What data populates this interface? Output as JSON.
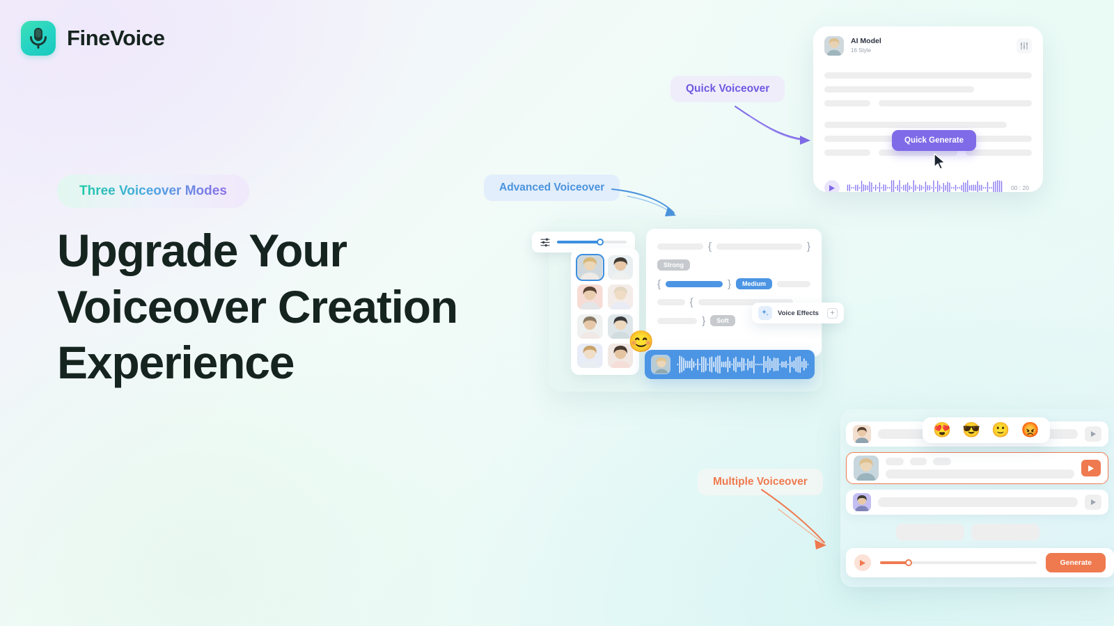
{
  "brand": {
    "name": "FineVoice",
    "logo_icon": "microphone-icon",
    "logo_color": "#2ed3b7"
  },
  "hero": {
    "badge": "Three Voiceover Modes",
    "headline": "Upgrade Your Voiceover Creation Experience",
    "headline_color": "#16241f"
  },
  "callouts": {
    "quick": {
      "label": "Quick Voiceover",
      "color": "#6f5ae0",
      "bg": "#f0edfb"
    },
    "advanced": {
      "label": "Advanced Voiceover",
      "color": "#4a93dd",
      "bg": "#e2eefb"
    },
    "multiple": {
      "label": "Multiple Voiceover",
      "color": "#ef7a50",
      "bg": "#f1f7f4"
    }
  },
  "quick_card": {
    "model_name": "AI Model",
    "model_style": "16 Style",
    "eq_icon": "equalizer-icon",
    "generate_label": "Quick Generate",
    "generate_color": "#7f6ae8",
    "cursor_icon": "mouse-cursor-icon",
    "play_icon": "play-icon",
    "duration": "00 : 20",
    "waveform_color": "#8b7cf0"
  },
  "advanced_card": {
    "slider_icon": "sliders-icon",
    "slider_value": 62,
    "slider_color": "#3d8fe0",
    "avatar_count": 8,
    "selected_avatar_index": 0,
    "tags": [
      {
        "label": "Strong",
        "state": "inactive"
      },
      {
        "label": "Medium",
        "state": "active"
      },
      {
        "label": "Soft",
        "state": "inactive"
      }
    ],
    "active_tag_color": "#4c95e4",
    "voice_effects": {
      "label": "Voice Effects",
      "icon": "sparkle-icon",
      "add_label": "+"
    },
    "emoji": "smiling-face",
    "waveform_color": "#4c95e4"
  },
  "multiple_card": {
    "emoji_reactions": [
      "heart-eyes",
      "sunglasses-smile",
      "slight-smile",
      "angry-face"
    ],
    "rows": [
      {
        "play_icon": "play-icon",
        "selected": false
      },
      {
        "play_icon": "play-icon",
        "selected": true
      },
      {
        "play_icon": "play-icon",
        "selected": false
      }
    ],
    "selected_row_color": "#ef7a50",
    "play_icon": "play-icon",
    "slider_value": 18,
    "generate_label": "Generate",
    "generate_color": "#ef7a50"
  }
}
